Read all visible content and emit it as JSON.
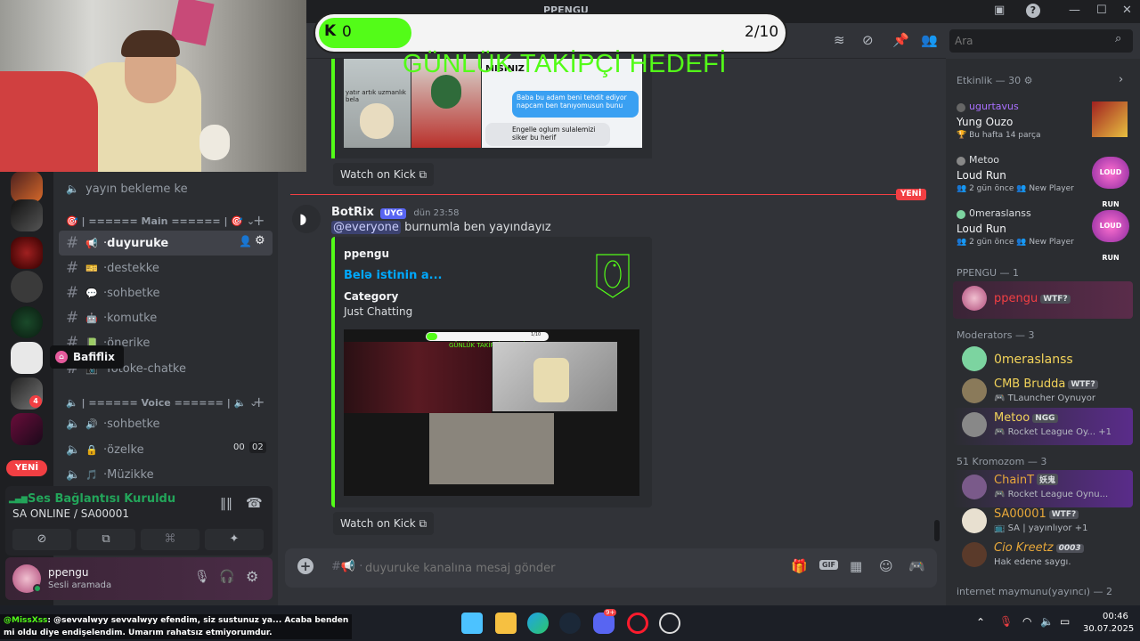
{
  "app": {
    "title": "PPENGU"
  },
  "stream_overlay": {
    "goal_count": "0",
    "goal_progress": "2/10",
    "goal_title": "GÜNLÜK TAKİPÇİ HEDEFİ",
    "goal_fraction": 0.2
  },
  "top_embed": {
    "img_caption1": "yatır artık uzmanlık bela",
    "img_caption2": "MISINIZ",
    "bubble1": "Baba bu adam beni tehdit ediyor napcam ben tanıyomusun bunu",
    "bubble2": "Engelle oglum sulalemizi siker bu herif",
    "watch_label": "Watch on Kick"
  },
  "divider": {
    "label": "YENİ"
  },
  "message": {
    "author": "BotRix",
    "tag": "UYG",
    "time": "dün 23:58",
    "mention": "@everyone",
    "text": "burnumla ben yayındayız",
    "embed": {
      "provider": "ppengu",
      "title": "Belə istinin a...",
      "field_name": "Category",
      "field_value": "Just Chatting",
      "thumb_goal": "GÜNLÜK TAKİPÇİ HEDEFİ",
      "thumb_progress": "1/10"
    },
    "watch_label": "Watch on Kick"
  },
  "sidebar": {
    "top_channel": "yayın bekleme ke",
    "cat_main": "| ====== Main ====== |",
    "channels": [
      {
        "label": "duyuruke",
        "emoji": "📢",
        "active": true
      },
      {
        "label": "destekke",
        "emoji": "🎫"
      },
      {
        "label": "sohbetke",
        "emoji": "💬"
      },
      {
        "label": "komutke",
        "emoji": "🤖"
      },
      {
        "label": "önerike",
        "emoji": "📗"
      },
      {
        "label": "fotoke-chatke",
        "emoji": "📷"
      }
    ],
    "cat_voice": "| ====== Voice ====== |",
    "voice_channels": [
      {
        "label": "sohbetke",
        "emoji": "🔊"
      },
      {
        "label": "özelke",
        "emoji": "🔒",
        "count_a": "00",
        "count_b": "02"
      },
      {
        "label": "Müzikke",
        "emoji": "🎵"
      }
    ],
    "tooltip": "Bafiflix",
    "new_label": "YENİ"
  },
  "voice_panel": {
    "status": "Ses Bağlantısı Kuruldu",
    "server": "SA ONLINE / SA00001"
  },
  "user_panel": {
    "name": "ppengu",
    "status": "Sesli aramada"
  },
  "composer": {
    "placeholder": "duyuruke kanalına mesaj gönder",
    "gif": "GIF"
  },
  "search": {
    "placeholder": "Ara"
  },
  "members": {
    "activity_header": "Etkinlik — 30",
    "activities": [
      {
        "user": "ugurtavus",
        "title": "Yung Ouzo",
        "sub": "Bu hafta 14 parça",
        "user_color": "#a970ff"
      },
      {
        "user": "Metoo",
        "title": "Loud Run",
        "sub": "2 gün önce",
        "sub2": "New Player",
        "user_color": "#dbdee1"
      },
      {
        "user": "0meraslanss",
        "title": "Loud Run",
        "sub": "2 gün önce",
        "sub2": "New Player",
        "user_color": "#dbdee1"
      }
    ],
    "group1_header": "PPENGU — 1",
    "owner": {
      "name": "ppengu",
      "tag": "WTF?"
    },
    "group2_header": "Moderators — 3",
    "mods": [
      {
        "name": "0meraslanss",
        "sub": ""
      },
      {
        "name": "CMB Brudda",
        "tag": "WTF?",
        "sub": "TLauncher Oynuyor"
      },
      {
        "name": "Metoo",
        "tag": "NGG",
        "sub": "Rocket League Oy...",
        "extra": "+1"
      }
    ],
    "group3_header": "51 Kromozom — 3",
    "k51": [
      {
        "name": "ChainT",
        "tag": "妖鬼",
        "sub": "Rocket League Oynu..."
      },
      {
        "name": "SA00001",
        "tag": "WTF?",
        "sub": "SA | yayınlıyor",
        "extra": "+1"
      },
      {
        "name": "Cio Kreetz",
        "tag": "0003",
        "sub": "Hak edene saygı."
      }
    ],
    "group4_header": "internet maymunu(yayıncı) — 2"
  },
  "ticker": {
    "user": "@MissXss",
    "line1": ": @sevvalwyy sevvalwyy efendim, siz sustunuz ya... Acaba benden",
    "line2": "mi oldu diye endişelendim. Umarım rahatsız etmiyorumdur."
  },
  "taskbar": {
    "time": "00:46",
    "date": "30.07.2025",
    "discord_badge": "9+"
  },
  "colors": {
    "kick_green": "#53fc18",
    "discord_blurple": "#5865f2",
    "red": "#f23f43"
  }
}
